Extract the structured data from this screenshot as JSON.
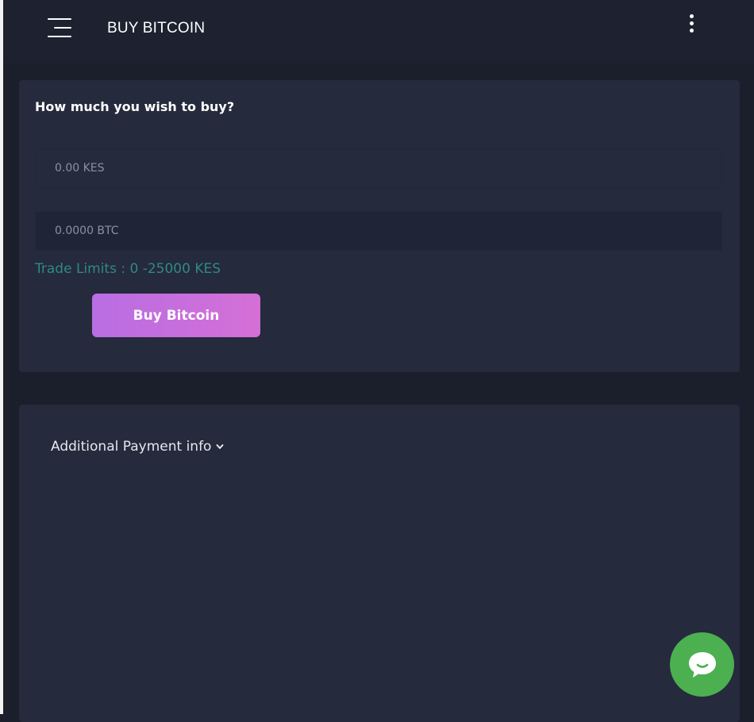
{
  "header": {
    "title": "BUY BITCOIN",
    "menu_icon": "hamburger-menu-icon",
    "more_icon": "kebab-more-icon"
  },
  "buy_form": {
    "question": "How much you wish to buy?",
    "kes_placeholder": "0.00 KES",
    "btc_placeholder": "0.0000 BTC",
    "trade_limits": "Trade Limits : 0 -25000 KES",
    "buy_button": "Buy Bitcoin"
  },
  "additional_info": {
    "toggle_label": "Additional Payment info",
    "toggle_icon": "chevron-down-icon"
  },
  "chat": {
    "icon": "chat-bubble-icon"
  },
  "colors": {
    "background": "#1b1e2b",
    "card": "#252a3c",
    "accent_gradient_start": "#b86ee3",
    "accent_gradient_end": "#d56fd6",
    "trade_limits": "#2f8a85",
    "chat_button": "#4caf50"
  }
}
